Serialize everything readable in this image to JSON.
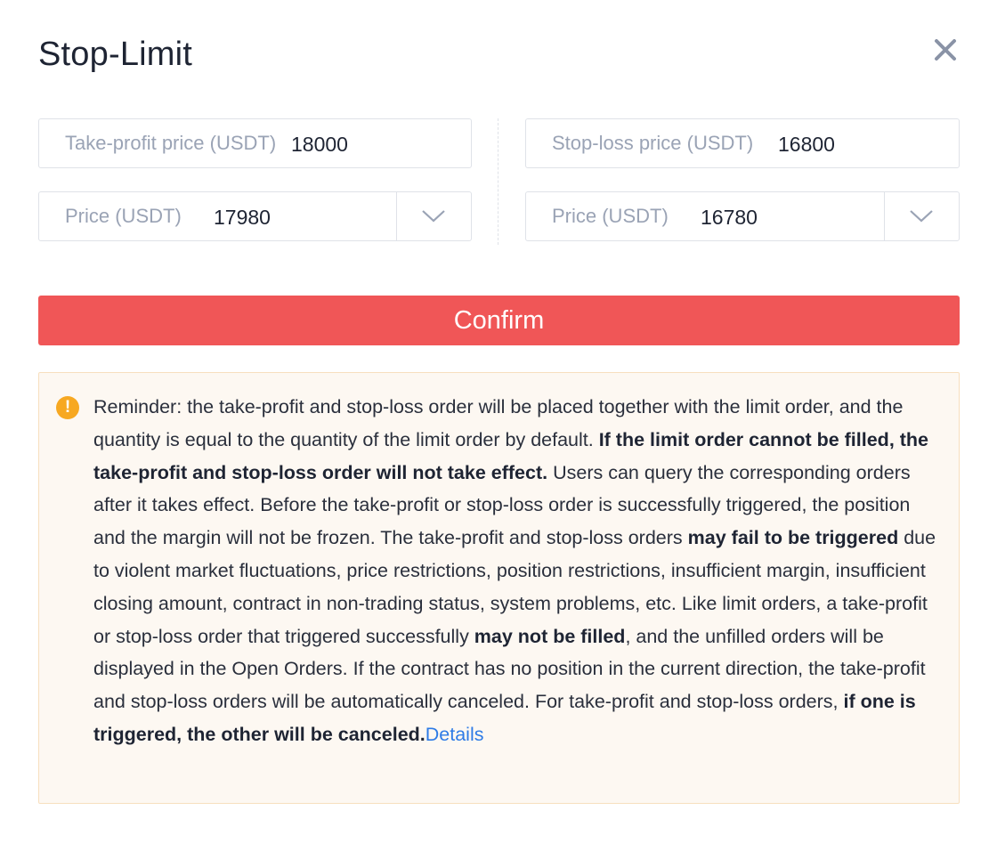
{
  "dialog": {
    "title": "Stop-Limit",
    "close_icon": "close-icon"
  },
  "take_profit": {
    "trigger_label": "Take-profit price (USDT)",
    "trigger_value": "18000",
    "price_label": "Price (USDT)",
    "price_value": "17980",
    "dropdown_icon": "chevron-down-icon"
  },
  "stop_loss": {
    "trigger_label": "Stop-loss price (USDT)",
    "trigger_value": "16800",
    "price_label": "Price (USDT)",
    "price_value": "16780",
    "dropdown_icon": "chevron-down-icon"
  },
  "confirm_label": "Confirm",
  "notice": {
    "icon": "warning-icon",
    "icon_glyph": "!",
    "segments": [
      "Reminder: the take-profit and stop-loss order will be placed together with the limit order, and the quantity is equal to the quantity of the limit order by default. ",
      "If the limit order cannot be filled, the take-profit and stop-loss order will not take effect.",
      " Users can query the corresponding orders after it takes effect. Before the take-profit or stop-loss order is successfully triggered, the position and the margin will not be frozen. The take-profit and stop-loss orders ",
      "may fail to be triggered",
      " due to violent market fluctuations, price restrictions, position restrictions, insufficient margin, insufficient closing amount, contract in non-trading status, system problems, etc. Like limit orders, a take-profit or stop-loss order that triggered successfully ",
      "may not be filled",
      ", and the unfilled orders will be displayed in the Open Orders. If the contract has no position in the current direction, the take-profit and stop-loss orders will be automatically canceled. For take-profit and stop-loss orders, ",
      "if one is triggered, the other will be canceled."
    ],
    "link_label": "Details"
  },
  "colors": {
    "confirm_bg": "#f05657",
    "warning": "#f7a821",
    "link": "#2e7be6",
    "notice_bg": "#fdf8f2",
    "notice_border": "#f7dfbe"
  }
}
